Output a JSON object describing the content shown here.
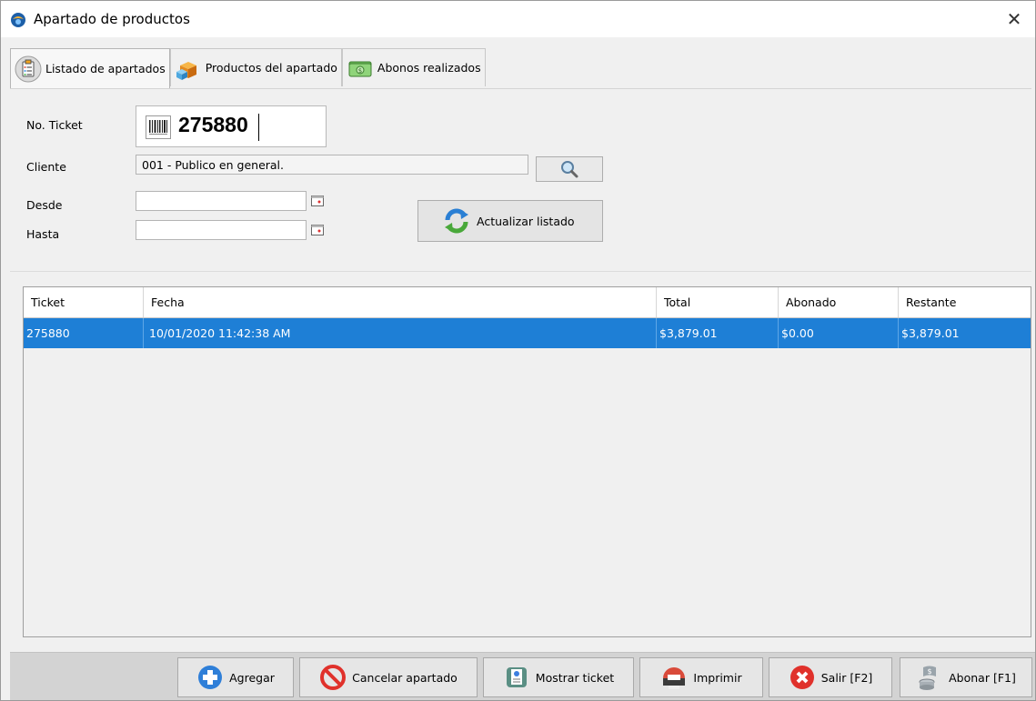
{
  "window": {
    "title": "Apartado de productos",
    "close_glyph": "✕"
  },
  "tabs": [
    {
      "label": "Listado de apartados",
      "icon": "clipboard-list-icon",
      "active": true
    },
    {
      "label": "Productos del apartado",
      "icon": "boxes-icon",
      "active": false
    },
    {
      "label": "Abonos realizados",
      "icon": "money-icon",
      "active": false
    }
  ],
  "form": {
    "ticket_label": "No. Ticket",
    "ticket_value": "275880",
    "cliente_label": "Cliente",
    "cliente_value": "001 - Publico en general.",
    "desde_label": "Desde",
    "desde_value": "",
    "hasta_label": "Hasta",
    "hasta_value": "",
    "refresh_label": "Actualizar listado"
  },
  "grid": {
    "columns": [
      "Ticket",
      "Fecha",
      "Total",
      "Abonado",
      "Restante"
    ],
    "rows": [
      {
        "ticket": "275880",
        "fecha": "10/01/2020 11:42:38 AM",
        "total": "$3,879.01",
        "abonado": "$0.00",
        "restante": "$3,879.01",
        "selected": true
      }
    ]
  },
  "footer": {
    "agregar": "Agregar",
    "cancelar": "Cancelar apartado",
    "mostrar": "Mostrar ticket",
    "imprimir": "Imprimir",
    "salir": "Salir [F2]",
    "abonar": "Abonar [F1]"
  },
  "colors": {
    "selection": "#1e7fd6",
    "footer_bg": "#d3d3d3"
  }
}
